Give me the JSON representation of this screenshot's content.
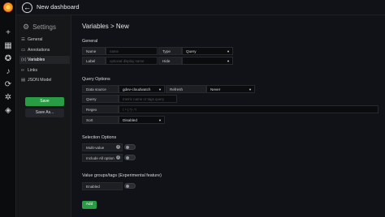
{
  "topbar": {
    "title": "New dashboard",
    "back_icon": "arrow-left-icon"
  },
  "rail": {
    "icons": [
      "grafana-logo",
      "plus-icon",
      "apps-icon",
      "compass-icon",
      "bell-icon",
      "share-icon",
      "gear-icon",
      "shield-icon"
    ]
  },
  "sidebar": {
    "heading": "Settings",
    "items": [
      {
        "label": "General",
        "icon": "sliders-icon"
      },
      {
        "label": "Annotations",
        "icon": "comment-icon"
      },
      {
        "label": "Variables",
        "icon": "dollar-icon"
      },
      {
        "label": "Links",
        "icon": "link-icon"
      },
      {
        "label": "JSON Model",
        "icon": "code-icon"
      }
    ],
    "active_index": 2,
    "save_label": "Save",
    "save_as_label": "Save As..."
  },
  "main": {
    "title": "Variables > New",
    "general": {
      "heading": "General",
      "name_label": "Name",
      "name_placeholder": "name",
      "type_label": "Type",
      "type_value": "Query",
      "label_label": "Label",
      "label_placeholder": "optional display name",
      "hide_label": "Hide",
      "hide_value": ""
    },
    "query_options": {
      "heading": "Query Options",
      "datasource_label": "Data source",
      "datasource_value": "gdev-cloudwatch",
      "refresh_label": "Refresh",
      "refresh_value": "Never",
      "query_label": "Query",
      "query_placeholder": "metric name or tags query",
      "regex_label": "Regex",
      "regex_placeholder": "/.*-(.*)-.*/",
      "sort_label": "Sort",
      "sort_value": "Disabled"
    },
    "selection_options": {
      "heading": "Selection Options",
      "multi_label": "Multi-value",
      "include_all_label": "Include All option"
    },
    "value_groups": {
      "heading": "Value groups/tags (Experimental feature)",
      "enabled_label": "Enabled"
    },
    "add_label": "Add"
  },
  "colors": {
    "accent_green": "#299c46",
    "background": "#111217",
    "panel": "#161719"
  }
}
